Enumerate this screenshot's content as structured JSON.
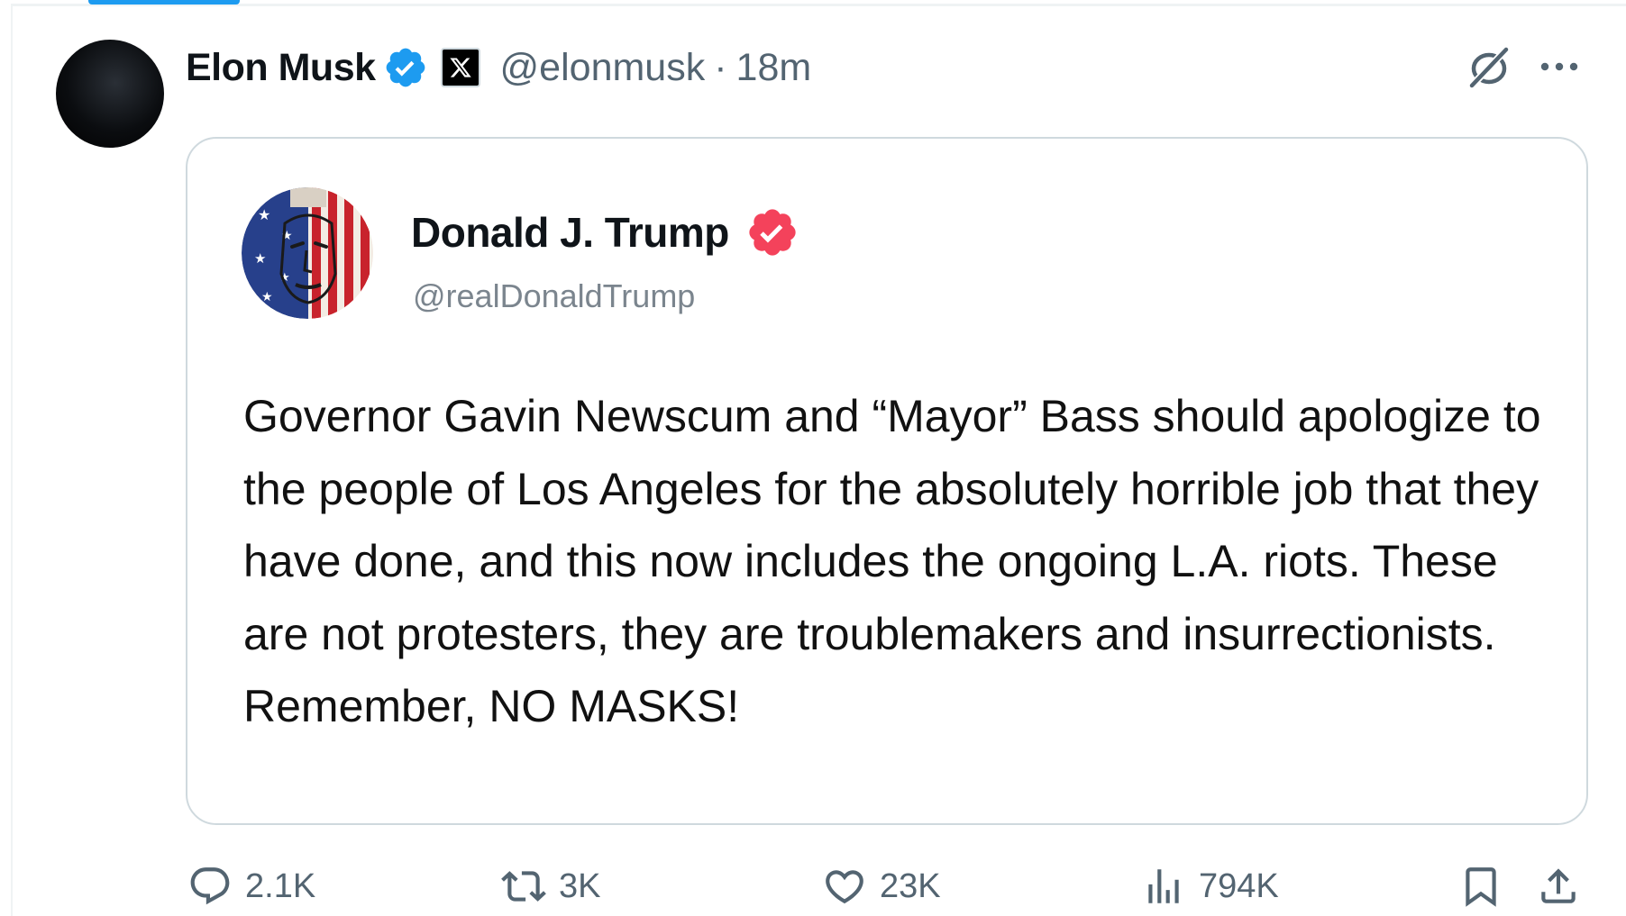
{
  "tweet": {
    "author": {
      "display_name": "Elon Musk",
      "handle": "@elonmusk",
      "avatar_icon": "dark-circle-avatar"
    },
    "separator": "·",
    "timestamp": "18m",
    "badges": [
      "verified-blue-icon",
      "x-affiliate-icon"
    ],
    "header_icons": [
      "grok-icon",
      "more-icon"
    ]
  },
  "quote": {
    "author": {
      "display_name": "Donald J. Trump",
      "handle": "@realDonaldTrump",
      "avatar_icon": "flag-painted-face-avatar"
    },
    "badge": "verified-red-icon",
    "text": "Governor Gavin Newscum and “Mayor” Bass should apologize to the people of Los Angeles for the absolutely horrible job that they have done, and this now includes the ongoing L.A. riots. These are not protesters, they are troublemakers and insurrectionists. Remember, NO MASKS!"
  },
  "actions": {
    "reply": {
      "count": "2.1K",
      "icon": "reply-icon"
    },
    "retweet": {
      "count": "3K",
      "icon": "retweet-icon"
    },
    "like": {
      "count": "23K",
      "icon": "heart-icon"
    },
    "views": {
      "count": "794K",
      "icon": "views-icon"
    },
    "bookmark": {
      "icon": "bookmark-icon"
    },
    "share": {
      "icon": "share-icon"
    }
  },
  "colors": {
    "text": "#0f1419",
    "secondary": "#536471",
    "border": "#cfd9de",
    "accent_blue": "#1d9bf0",
    "badge_red": "#f4425b"
  }
}
